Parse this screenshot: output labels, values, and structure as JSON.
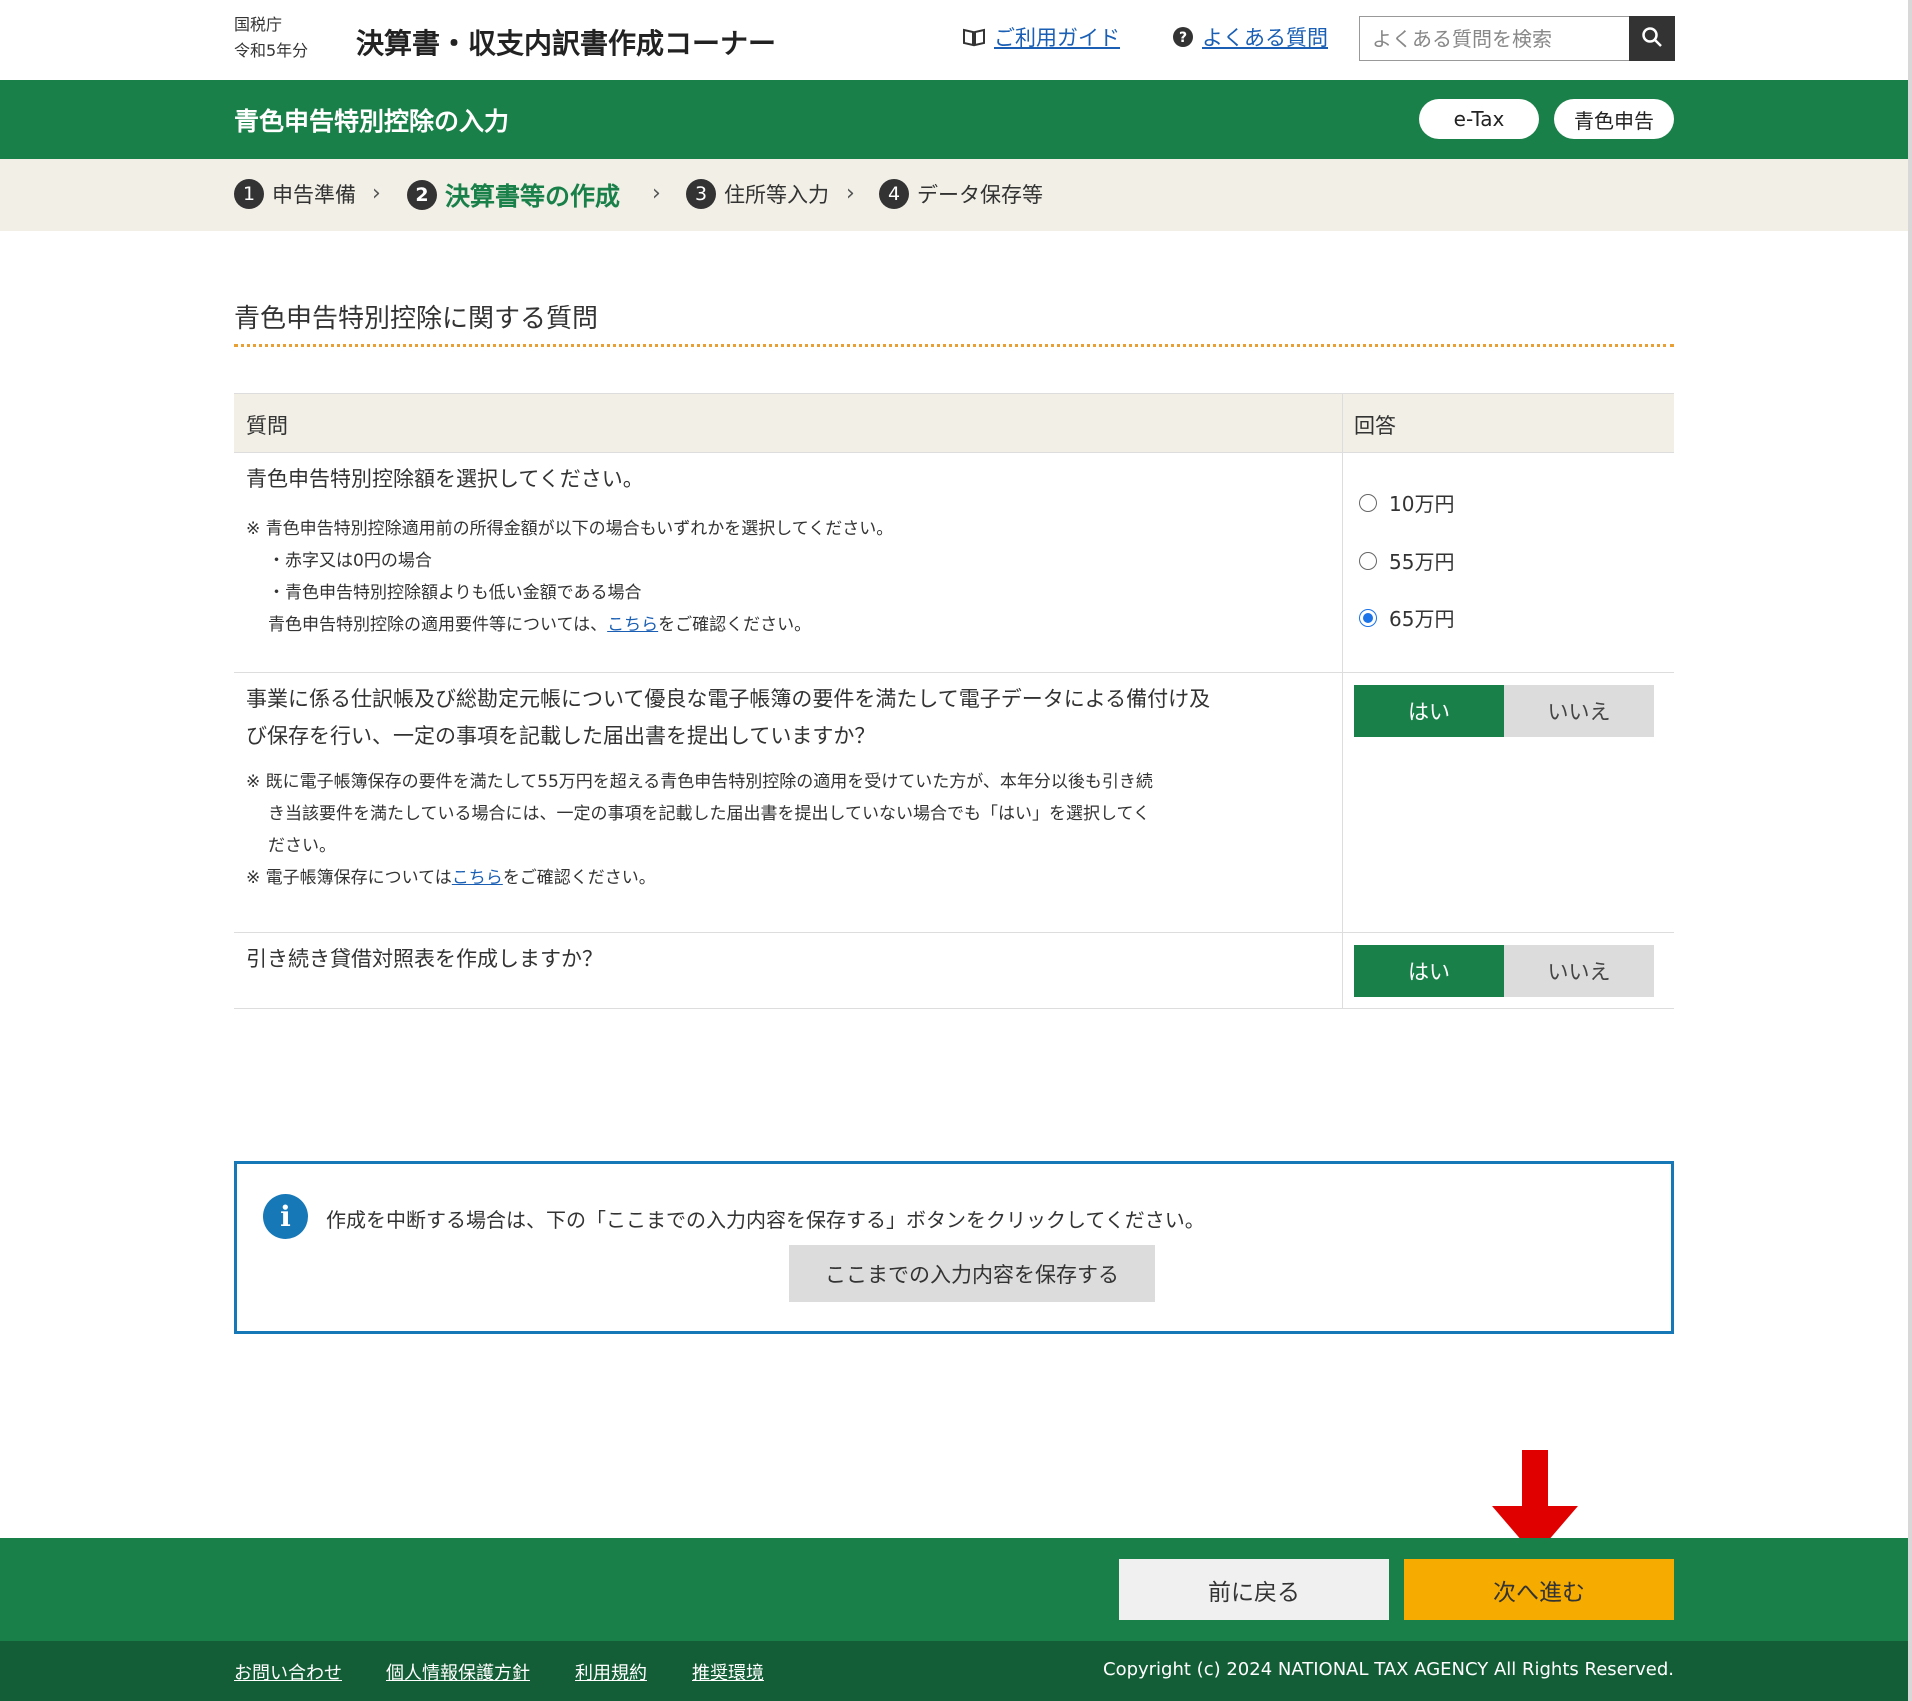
{
  "header": {
    "agency": "国税庁",
    "year": "令和5年分",
    "title": "決算書・収支内訳書作成コーナー",
    "guide_link": "ご利用ガイド",
    "faq_link": "よくある質問",
    "search_placeholder": "よくある質問を検索"
  },
  "band": {
    "title": "青色申告特別控除の入力",
    "pills": [
      "e-Tax",
      "青色申告"
    ]
  },
  "steps": [
    {
      "num": "1",
      "label": "申告準備"
    },
    {
      "num": "2",
      "label": "決算書等の作成"
    },
    {
      "num": "3",
      "label": "住所等入力"
    },
    {
      "num": "4",
      "label": "データ保存等"
    }
  ],
  "section": {
    "title": "青色申告特別控除に関する質問"
  },
  "table": {
    "col_question": "質問",
    "col_answer": "回答",
    "q1": {
      "text": "青色申告特別控除額を選択してください。",
      "notes": [
        "※ 青色申告特別控除適用前の所得金額が以下の場合もいずれかを選択してください。",
        "・赤字又は0円の場合",
        "・青色申告特別控除額よりも低い金額である場合"
      ],
      "note_tail_pre": "青色申告特別控除の適用要件等については、",
      "note_tail_link": "こちら",
      "note_tail_post": "をご確認ください。",
      "options": [
        "10万円",
        "55万円",
        "65万円"
      ],
      "selected": "65万円"
    },
    "q2": {
      "text_line1": "事業に係る仕訳帳及び総勘定元帳について優良な電子帳簿の要件を満たして電子データによる備付け及",
      "text_line2": "び保存を行い、一定の事項を記載した届出書を提出していますか？",
      "note1_line1": "※ 既に電子帳簿保存の要件を満たして55万円を超える青色申告特別控除の適用を受けていた方が、本年分以後も引き続",
      "note1_line2": "き当該要件を満たしている場合には、一定の事項を記載した届出書を提出していない場合でも「はい」を選択してく",
      "note1_line3": "ださい。",
      "note2_pre": "※ 電子帳簿保存については",
      "note2_link": "こちら",
      "note2_post": "をご確認ください。",
      "yes": "はい",
      "no": "いいえ",
      "selected": "はい"
    },
    "q3": {
      "text": "引き続き貸借対照表を作成しますか？",
      "yes": "はい",
      "no": "いいえ",
      "selected": "はい"
    }
  },
  "info": {
    "text": "作成を中断する場合は、下の「ここまでの入力内容を保存する」ボタンをクリックしてください。",
    "save_button": "ここまでの入力内容を保存する"
  },
  "nav": {
    "back": "前に戻る",
    "next": "次へ進む"
  },
  "footer": {
    "links": [
      "お問い合わせ",
      "個人情報保護方針",
      "利用規約",
      "推奨環境"
    ],
    "copyright": "Copyright (c) 2024 NATIONAL TAX AGENCY All Rights Reserved."
  },
  "colors": {
    "brand_green": "#1a8049",
    "dark_green": "#135e36",
    "next_yellow": "#f5ab00",
    "info_blue": "#1778b8",
    "arrow_red": "#e00000"
  },
  "icons": [
    "book-icon",
    "question-icon",
    "search-icon",
    "info-icon",
    "down-arrow-icon"
  ]
}
